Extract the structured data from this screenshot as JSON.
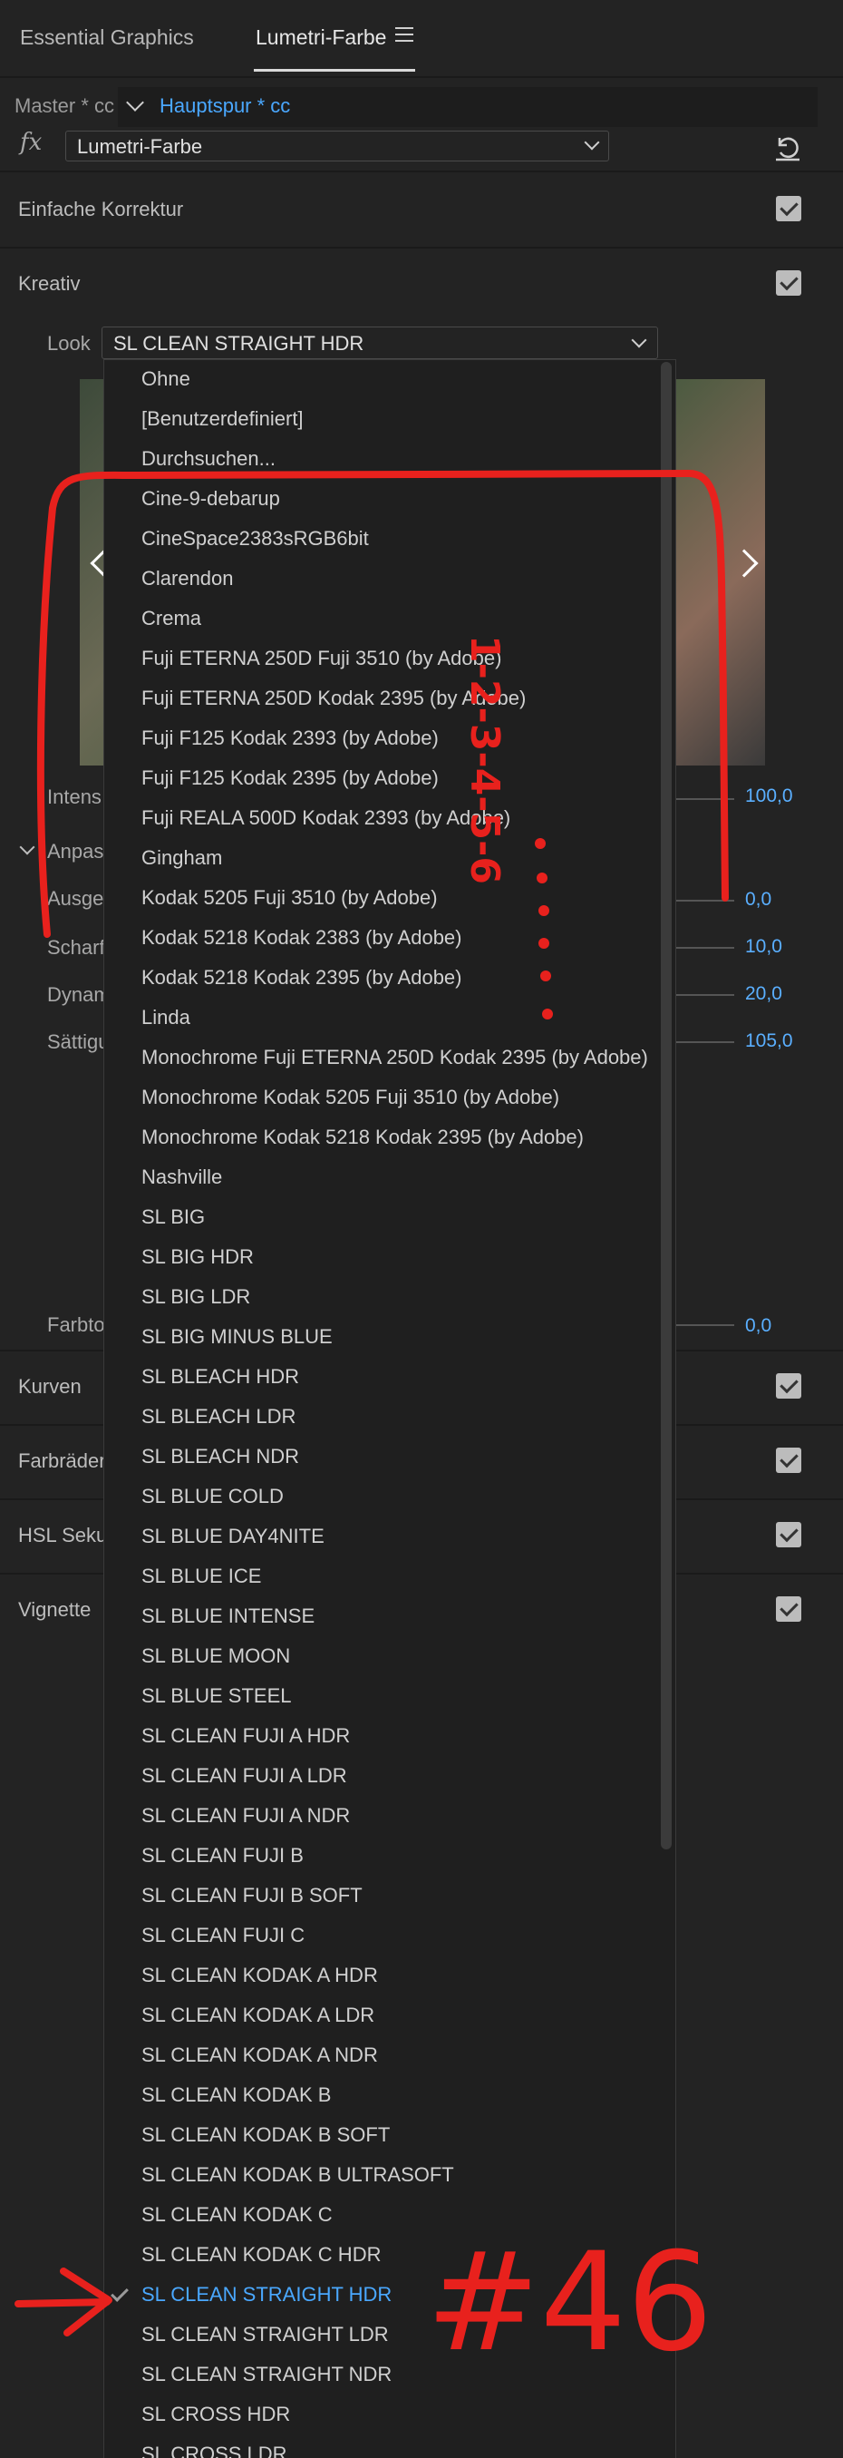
{
  "tabs": {
    "essential_graphics": "Essential Graphics",
    "lumetri_farbe": "Lumetri-Farbe"
  },
  "source": {
    "master": "Master * cc",
    "track": "Hauptspur * cc"
  },
  "effect": {
    "fx_symbol": "fx",
    "selected": "Lumetri-Farbe"
  },
  "sections": {
    "einfache_korrektur": "Einfache Korrektur",
    "kreativ": "Kreativ",
    "kurven": "Kurven",
    "farbraeder": "Farbräder",
    "hsl": "HSL Seku",
    "vignette": "Vignette"
  },
  "look": {
    "label": "Look",
    "selected": "SL CLEAN STRAIGHT HDR"
  },
  "params": {
    "intensitaet": {
      "label": "Intens",
      "value": "100,0"
    },
    "anpassungen": {
      "label": "Anpas"
    },
    "ausgeblichen": {
      "label": "Ausge",
      "value": "0,0"
    },
    "scharf": {
      "label": "Scharf",
      "value": "10,0"
    },
    "dynamik": {
      "label": "Dynam",
      "value": "20,0"
    },
    "saettigung": {
      "label": "Sättigu",
      "value": "105,0"
    },
    "farbton": {
      "label": "Farbto",
      "value": "0,0"
    }
  },
  "dropdown_items": [
    "Ohne",
    "[Benutzerdefiniert]",
    "Durchsuchen...",
    "Cine-9-debarup",
    "CineSpace2383sRGB6bit",
    "Clarendon",
    "Crema",
    "Fuji ETERNA 250D Fuji 3510 (by Adobe)",
    "Fuji ETERNA 250D Kodak 2395 (by Adobe)",
    "Fuji F125 Kodak 2393 (by Adobe)",
    "Fuji F125 Kodak 2395 (by Adobe)",
    "Fuji REALA 500D Kodak 2393 (by Adobe)",
    "Gingham",
    "Kodak 5205 Fuji 3510 (by Adobe)",
    "Kodak 5218 Kodak 2383 (by Adobe)",
    "Kodak 5218 Kodak 2395 (by Adobe)",
    "Linda",
    "Monochrome Fuji ETERNA 250D Kodak 2395 (by Adobe)",
    "Monochrome Kodak 5205 Fuji 3510 (by Adobe)",
    "Monochrome Kodak 5218 Kodak 2395 (by Adobe)",
    "Nashville",
    "SL BIG",
    "SL BIG HDR",
    "SL BIG LDR",
    "SL BIG MINUS BLUE",
    "SL BLEACH HDR",
    "SL BLEACH LDR",
    "SL BLEACH NDR",
    "SL BLUE COLD",
    "SL BLUE DAY4NITE",
    "SL BLUE ICE",
    "SL BLUE INTENSE",
    "SL BLUE MOON",
    "SL BLUE STEEL",
    "SL CLEAN FUJI A HDR",
    "SL CLEAN FUJI A LDR",
    "SL CLEAN FUJI A NDR",
    "SL CLEAN FUJI B",
    "SL CLEAN FUJI B SOFT",
    "SL CLEAN FUJI C",
    "SL CLEAN KODAK A HDR",
    "SL CLEAN KODAK A LDR",
    "SL CLEAN KODAK A NDR",
    "SL CLEAN KODAK B",
    "SL CLEAN KODAK B SOFT",
    "SL CLEAN KODAK B ULTRASOFT",
    "SL CLEAN KODAK C",
    "SL CLEAN KODAK C HDR",
    "SL CLEAN STRAIGHT HDR",
    "SL CLEAN STRAIGHT LDR",
    "SL CLEAN STRAIGHT NDR",
    "SL CROSS HDR",
    "SL CROSS LDR"
  ],
  "selected_item": "SL CLEAN STRAIGHT HDR",
  "annotation": {
    "vertical_text": "1-2-3-4-5-6",
    "number": "#46",
    "color": "#e8211d"
  }
}
